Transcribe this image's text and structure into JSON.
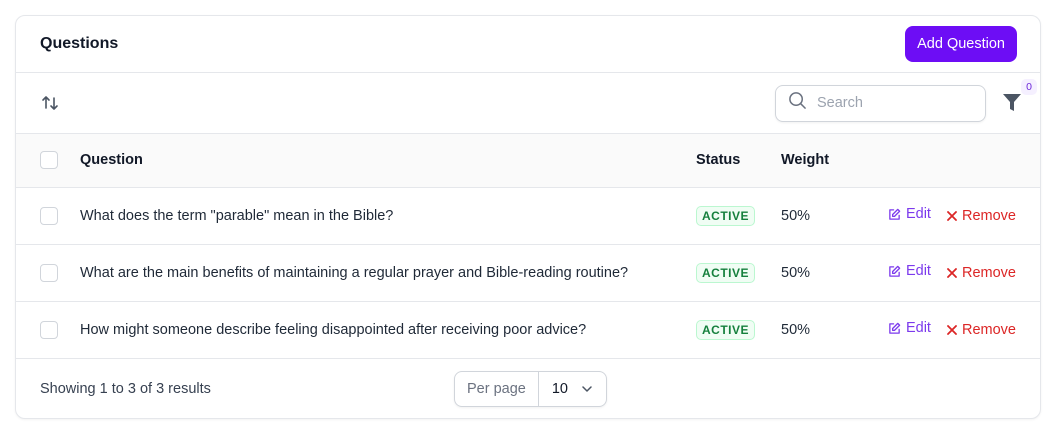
{
  "header": {
    "title": "Questions",
    "add_button": "Add Question"
  },
  "toolbar": {
    "search_placeholder": "Search",
    "filter_count": "0"
  },
  "table": {
    "columns": {
      "question": "Question",
      "status": "Status",
      "weight": "Weight"
    },
    "rows": [
      {
        "question": "What does the term \"parable\" mean in the Bible?",
        "status": "ACTIVE",
        "weight": "50%"
      },
      {
        "question": "What are the main benefits of maintaining a regular prayer and Bible-reading routine?",
        "status": "ACTIVE",
        "weight": "50%"
      },
      {
        "question": "How might someone describe feeling disappointed after receiving poor advice?",
        "status": "ACTIVE",
        "weight": "50%"
      }
    ],
    "actions": {
      "edit": "Edit",
      "remove": "Remove"
    }
  },
  "footer": {
    "showing": "Showing 1 to 3 of 3 results",
    "per_page_label": "Per page",
    "per_page_value": "10"
  },
  "colors": {
    "primary": "#6d0df5",
    "edit": "#7c3aed",
    "remove": "#dc2626",
    "active": "#15803d"
  }
}
